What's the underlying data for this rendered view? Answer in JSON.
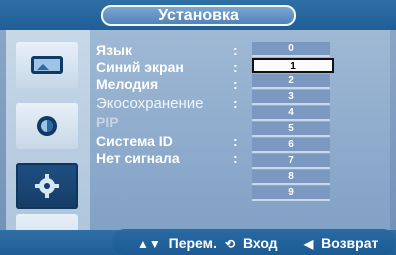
{
  "header": {
    "title": "Установка"
  },
  "menu": {
    "items": [
      {
        "label": "Язык",
        "has_colon": true,
        "style": "normal"
      },
      {
        "label": "Синий экран",
        "has_colon": true,
        "style": "normal"
      },
      {
        "label": "Мелодия",
        "has_colon": true,
        "style": "normal"
      },
      {
        "label": "Экосохранение",
        "has_colon": true,
        "style": "light"
      },
      {
        "label": "PIP",
        "has_colon": false,
        "style": "disabled"
      },
      {
        "label": "Система ID",
        "has_colon": true,
        "style": "normal"
      },
      {
        "label": "Нет сигнала",
        "has_colon": true,
        "style": "normal"
      }
    ]
  },
  "options": {
    "values": [
      "0",
      "1",
      "2",
      "3",
      "4",
      "5",
      "6",
      "7",
      "8",
      "9"
    ],
    "selected_index": 1
  },
  "footer": {
    "move": {
      "icon": "up-down-icon",
      "label": "Перем."
    },
    "enter": {
      "icon": "enter-icon",
      "label": "Вход"
    },
    "back": {
      "icon": "left-triangle-icon",
      "label": "Возврат"
    }
  },
  "left_nav": {
    "icons": [
      "picture-icon",
      "sound-icon",
      "setup-gear-icon",
      "input-plug-icon"
    ],
    "active_index": 2
  }
}
